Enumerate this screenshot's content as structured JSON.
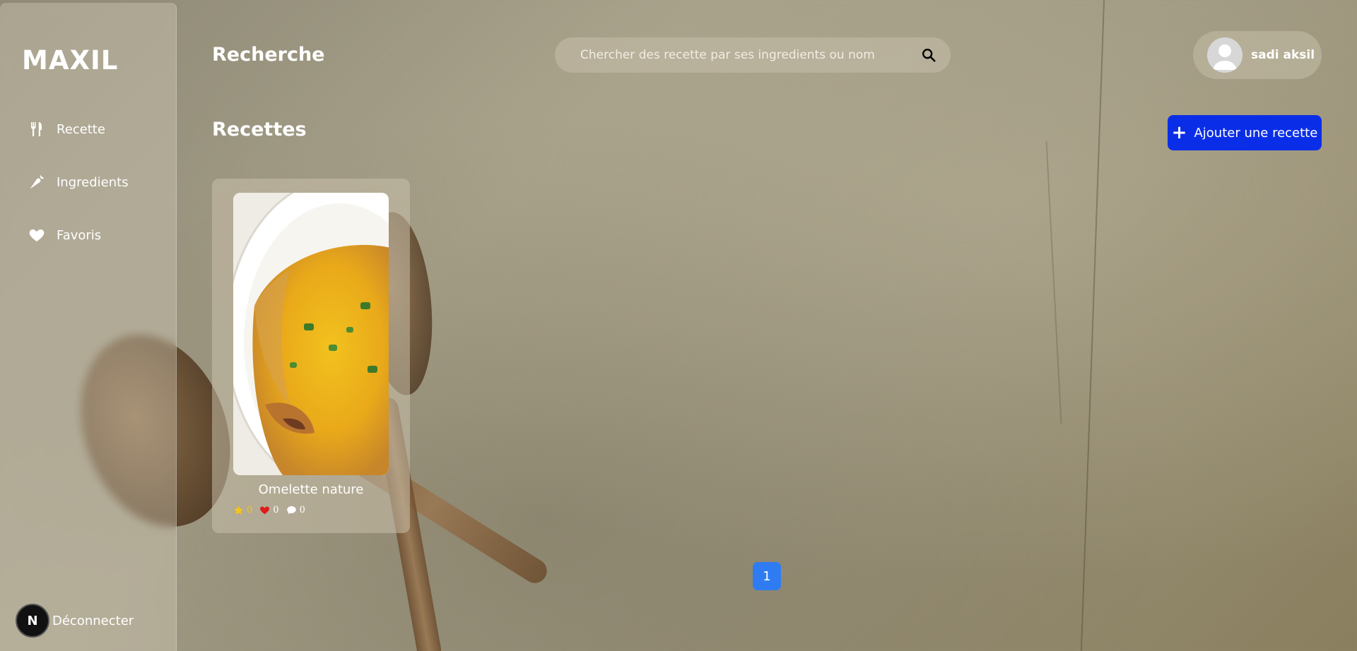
{
  "sidebar": {
    "logo": "MAXIL",
    "items": [
      {
        "label": "Recette",
        "icon": "utensils-icon"
      },
      {
        "label": "Ingredients",
        "icon": "carrot-icon"
      },
      {
        "label": "Favoris",
        "icon": "heart-icon"
      }
    ],
    "logout_label": "Déconnecter",
    "badge_letter": "N"
  },
  "header": {
    "title": "Recherche",
    "search_placeholder": "Chercher des recette par ses ingredients ou nom",
    "user_name": "sadi aksil"
  },
  "main": {
    "section_title": "Recettes",
    "add_button_label": "Ajouter une recette",
    "recipes": [
      {
        "title": "Omelette nature",
        "rating": "0",
        "likes": "0",
        "comments": "0"
      }
    ],
    "pagination": [
      "1"
    ]
  },
  "colors": {
    "accent": "#0a2ee8",
    "page_active": "#2f7cf2",
    "star": "#f5c518",
    "heart": "#e01b1b"
  }
}
